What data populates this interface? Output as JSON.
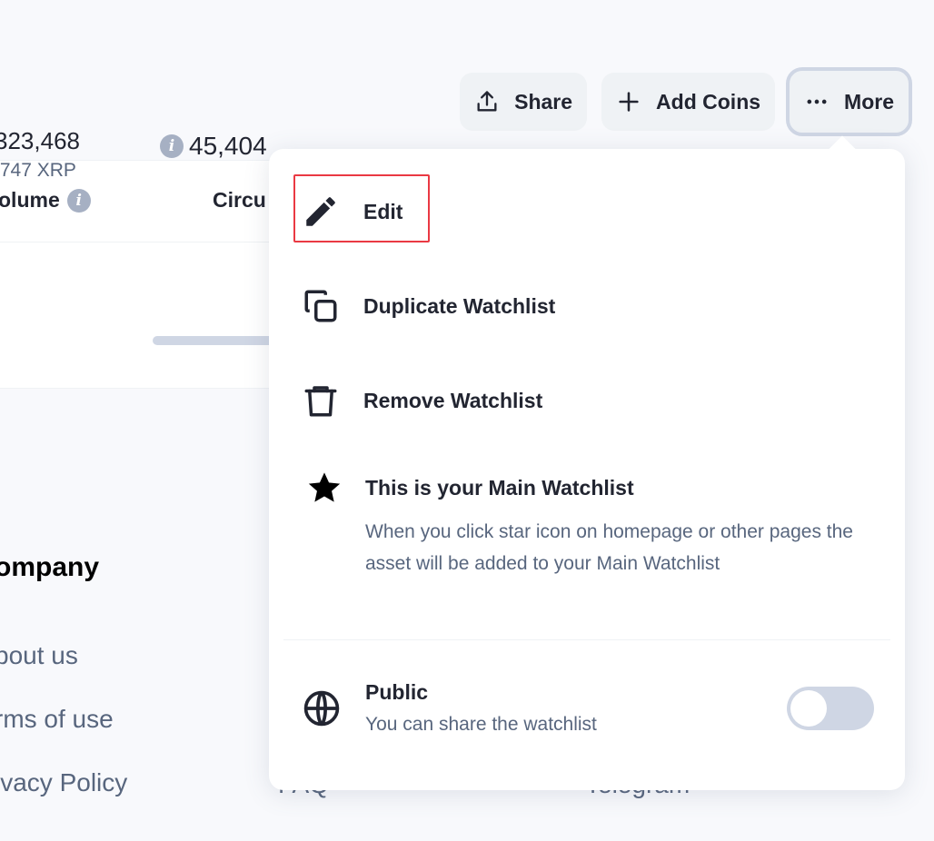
{
  "toolbar": {
    "share_label": "Share",
    "add_coins_label": "Add Coins",
    "more_label": "More"
  },
  "table": {
    "col_volume": "olume",
    "col_circulating": "Circu",
    "row": {
      "volume": "323,468",
      "volume_sub": ",747 XRP",
      "circulating": "45,404"
    }
  },
  "footer": {
    "company_heading": "ompany",
    "links": [
      "bout us",
      "rms of use",
      "ivacy Policy"
    ],
    "faq": "FAQ",
    "telegram": "Telegram"
  },
  "menu": {
    "edit_label": "Edit",
    "duplicate_label": "Duplicate Watchlist",
    "remove_label": "Remove Watchlist",
    "main_title": "This is your Main Watchlist",
    "main_desc": "When you click star icon on homepage or other pages the asset will be added to your Main Watchlist",
    "public_title": "Public",
    "public_sub": "You can share the watchlist",
    "public_enabled": false
  },
  "colors": {
    "highlight": "#ea3943",
    "muted_text": "#58667e",
    "button_bg": "#eff2f5"
  }
}
